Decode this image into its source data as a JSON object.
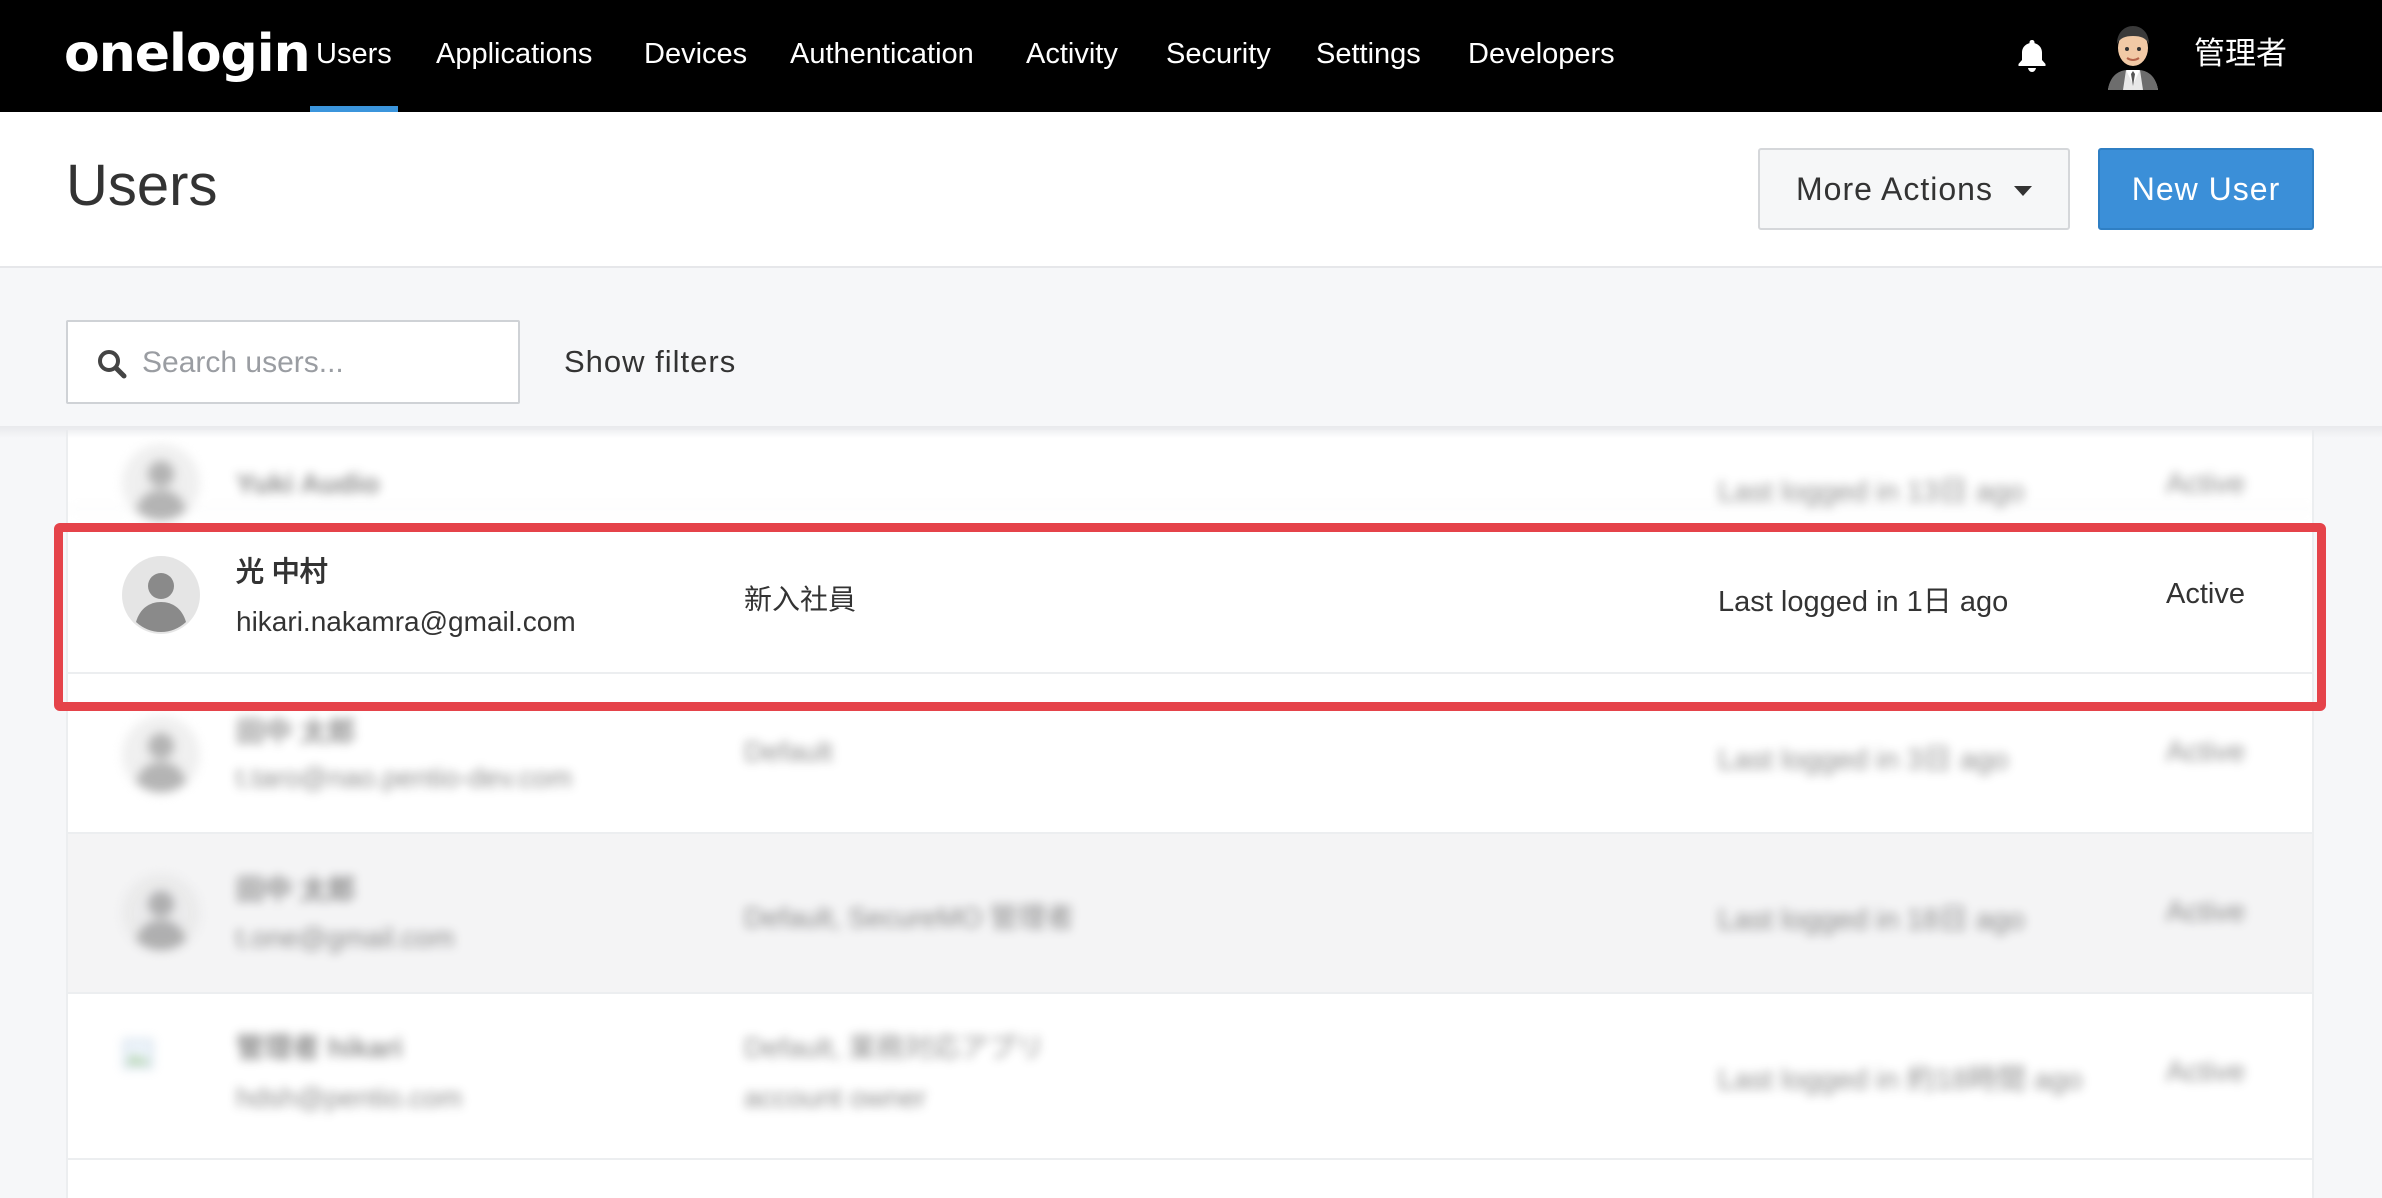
{
  "nav": {
    "logo": "onelogin",
    "items": [
      "Users",
      "Applications",
      "Devices",
      "Authentication",
      "Activity",
      "Security",
      "Settings",
      "Developers"
    ],
    "admin_name": "管理者"
  },
  "header": {
    "title": "Users",
    "more_actions": "More Actions",
    "new_user": "New User"
  },
  "search": {
    "placeholder": "Search users...",
    "show_filters": "Show filters"
  },
  "users": [
    {
      "name": "Yuki Audio",
      "email": "",
      "roles": "",
      "roles2": "",
      "last_login": "Last logged in 13日 ago",
      "status": "Active"
    },
    {
      "name": "光 中村",
      "email": "hikari.nakamra@gmail.com",
      "roles": "新入社員",
      "roles2": "",
      "last_login": "Last logged in 1日 ago",
      "status": "Active"
    },
    {
      "name": "田中 太郎",
      "email": "t.taro@nao.pentio-dev.com",
      "roles": "Default",
      "roles2": "",
      "last_login": "Last logged in 3日 ago",
      "status": "Active"
    },
    {
      "name": "田中 太郎",
      "email": "t.one@gmail.com",
      "roles": "Default, SecureMO 管理者",
      "roles2": "",
      "last_login": "Last logged in 18日 ago",
      "status": "Active"
    },
    {
      "name": "管理者 hikari",
      "email": "hdsh@pentio.com",
      "roles": "Default, 業務対応アプリ",
      "roles2": "account owner",
      "last_login": "Last logged in 約18時間 ago",
      "status": "Active"
    }
  ],
  "colors": {
    "accent": "#3b8fd8",
    "highlight": "#e5434a",
    "topbar": "#000000"
  }
}
